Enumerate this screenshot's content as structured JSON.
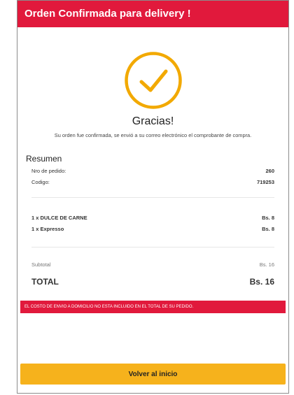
{
  "header": {
    "title": "Orden Confirmada para delivery !"
  },
  "confirmation": {
    "icon": "check-circle-icon",
    "thanks": "Gracias!",
    "message": "Su orden fue confirmada, se envió a su correo electrónico el comprobante de compra."
  },
  "summary": {
    "title": "Resumen",
    "order_number_label": "Nro de pedido:",
    "order_number_value": "260",
    "code_label": "Codigo:",
    "code_value": "719253"
  },
  "items": [
    {
      "label": "1 x DULCE DE CARNE",
      "price": "Bs. 8"
    },
    {
      "label": "1 x Expresso",
      "price": "Bs. 8"
    }
  ],
  "totals": {
    "subtotal_label": "Subtotal",
    "subtotal_value": "Bs. 16",
    "total_label": "TOTAL",
    "total_value": "Bs. 16"
  },
  "notice": "EL COSTO DE ENVIO A DOMICILIO NO ESTA INCLUIDO EN EL TOTAL DE SU PEDIDO.",
  "actions": {
    "back_label": "Volver al inicio"
  },
  "colors": {
    "brand_red": "#e1193c",
    "accent_yellow": "#f6b21c",
    "check_orange": "#f2a900"
  }
}
